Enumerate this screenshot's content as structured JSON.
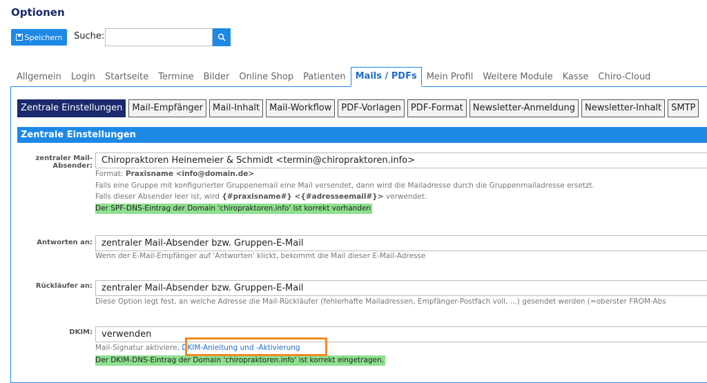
{
  "page": {
    "title": "Optionen"
  },
  "toolbar": {
    "save_label": "Speichern",
    "search_label": "Suche:",
    "search_value": ""
  },
  "tabs": [
    "Allgemein",
    "Login",
    "Startseite",
    "Termine",
    "Bilder",
    "Online Shop",
    "Patienten",
    "Mails / PDFs",
    "Mein Profil",
    "Weitere Module",
    "Kasse",
    "Chiro-Cloud"
  ],
  "active_tab": "Mails / PDFs",
  "subtabs": [
    "Zentrale Einstellungen",
    "Mail-Empfänger",
    "Mail-Inhalt",
    "Mail-Workflow",
    "PDF-Vorlagen",
    "PDF-Format",
    "Newsletter-Anmeldung",
    "Newsletter-Inhalt",
    "SMTP"
  ],
  "active_subtab": "Zentrale Einstellungen",
  "section": {
    "title": "Zentrale Einstellungen"
  },
  "fields": {
    "sender": {
      "label_line1": "zentraler Mail-",
      "label_line2": "Absender:",
      "value": "Chiropraktoren Heinemeier & Schmidt <termin@chiropraktoren.info>",
      "format_prefix": "Format: ",
      "format_value": "Praxisname <info@domain.de>",
      "hint1": "Falls eine Gruppe mit konfigurierter Gruppenemail eine Mail versendet, dann wird die Mailadresse durch die Gruppenmailadresse ersetzt.",
      "hint2_prefix": "Falls dieser Absender leer ist, wird ",
      "hint2_bold": "{#praxisname#} <{#adresseemail#}>",
      "hint2_suffix": " verwendet.",
      "status": "Der SPF-DNS-Eintrag der Domain 'chiropraktoren.info' ist korrekt vorhanden"
    },
    "reply_to": {
      "label": "Antworten an:",
      "value": "zentraler Mail-Absender bzw. Gruppen-E-Mail",
      "hint": "Wenn der E-Mail-Empfänger auf 'Antworten' klickt, bekommt die Mail dieser E-Mail-Adresse"
    },
    "bounce": {
      "label": "Rückläufer an:",
      "value": "zentraler Mail-Absender bzw. Gruppen-E-Mail",
      "hint": "Diese Option legt fest, an welche Adresse die Mail-Rückläufer (fehlerhafte Mailadressen, Empfänger-Postfach voll, ...) gesendet werden (=oberster FROM-Abs"
    },
    "dkim": {
      "label": "DKIM:",
      "value": "verwenden",
      "hint_prefix": "Mail-Signatur aktiviere",
      "hint_sep": ", ",
      "link": "DKIM-Anleitung und -Aktivierung",
      "status": "Der DKIM-DNS-Eintrag der Domain 'chiropraktoren.info' ist korrekt eingetragen."
    }
  },
  "colors": {
    "accent": "#1e88e5",
    "active_subtab": "#1a2a6c",
    "ok_bg": "#8ee08e",
    "highlight": "#f08a24"
  }
}
